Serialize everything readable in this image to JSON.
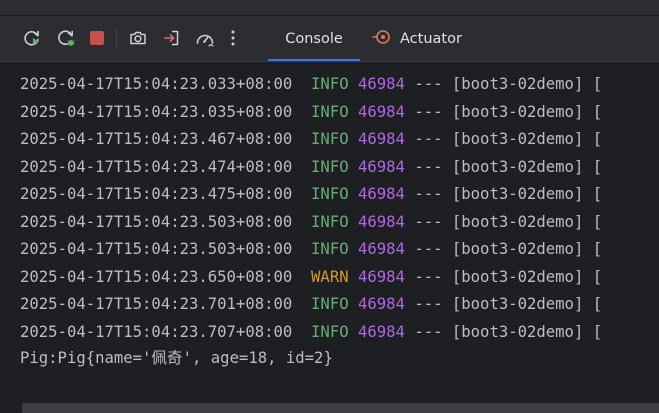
{
  "toolbar": {
    "buttons": [
      {
        "name": "rerun-icon",
        "label": "Rerun"
      },
      {
        "name": "rerun-debug-icon",
        "label": "Rerun failed"
      },
      {
        "name": "stop-icon",
        "label": "Stop"
      },
      {
        "name": "camera-icon",
        "label": "Screenshot"
      },
      {
        "name": "exit-icon",
        "label": "Exit"
      },
      {
        "name": "gauge-icon",
        "label": "Profiler"
      },
      {
        "name": "more-vertical-icon",
        "label": "More"
      }
    ],
    "tabs": [
      {
        "label": "Console",
        "selected": true
      },
      {
        "label": "Actuator",
        "selected": false
      }
    ]
  },
  "colors": {
    "background": "#1e1f22",
    "toolbar": "#2b2d30",
    "text": "#bcbec4",
    "info": "#6aab73",
    "warn": "#d19a27",
    "pid": "#b267e6",
    "stop": "#c94f4f",
    "run": "#5fb865",
    "actuator": "#e0795a",
    "accent": "#3574f0"
  },
  "console": {
    "lines": [
      {
        "timestamp": "2025-04-17T15:04:23.033+08:00",
        "level": "INFO",
        "pid": "46984",
        "rest": " --- [boot3-02demo] ["
      },
      {
        "timestamp": "2025-04-17T15:04:23.035+08:00",
        "level": "INFO",
        "pid": "46984",
        "rest": " --- [boot3-02demo] ["
      },
      {
        "timestamp": "2025-04-17T15:04:23.467+08:00",
        "level": "INFO",
        "pid": "46984",
        "rest": " --- [boot3-02demo] ["
      },
      {
        "timestamp": "2025-04-17T15:04:23.474+08:00",
        "level": "INFO",
        "pid": "46984",
        "rest": " --- [boot3-02demo] ["
      },
      {
        "timestamp": "2025-04-17T15:04:23.475+08:00",
        "level": "INFO",
        "pid": "46984",
        "rest": " --- [boot3-02demo] ["
      },
      {
        "timestamp": "2025-04-17T15:04:23.503+08:00",
        "level": "INFO",
        "pid": "46984",
        "rest": " --- [boot3-02demo] ["
      },
      {
        "timestamp": "2025-04-17T15:04:23.503+08:00",
        "level": "INFO",
        "pid": "46984",
        "rest": " --- [boot3-02demo] ["
      },
      {
        "timestamp": "2025-04-17T15:04:23.650+08:00",
        "level": "WARN",
        "pid": "46984",
        "rest": " --- [boot3-02demo] ["
      },
      {
        "timestamp": "2025-04-17T15:04:23.701+08:00",
        "level": "INFO",
        "pid": "46984",
        "rest": " --- [boot3-02demo] ["
      },
      {
        "timestamp": "2025-04-17T15:04:23.707+08:00",
        "level": "INFO",
        "pid": "46984",
        "rest": " --- [boot3-02demo] ["
      }
    ],
    "output": "Pig:Pig{name='佩奇', age=18, id=2}"
  }
}
